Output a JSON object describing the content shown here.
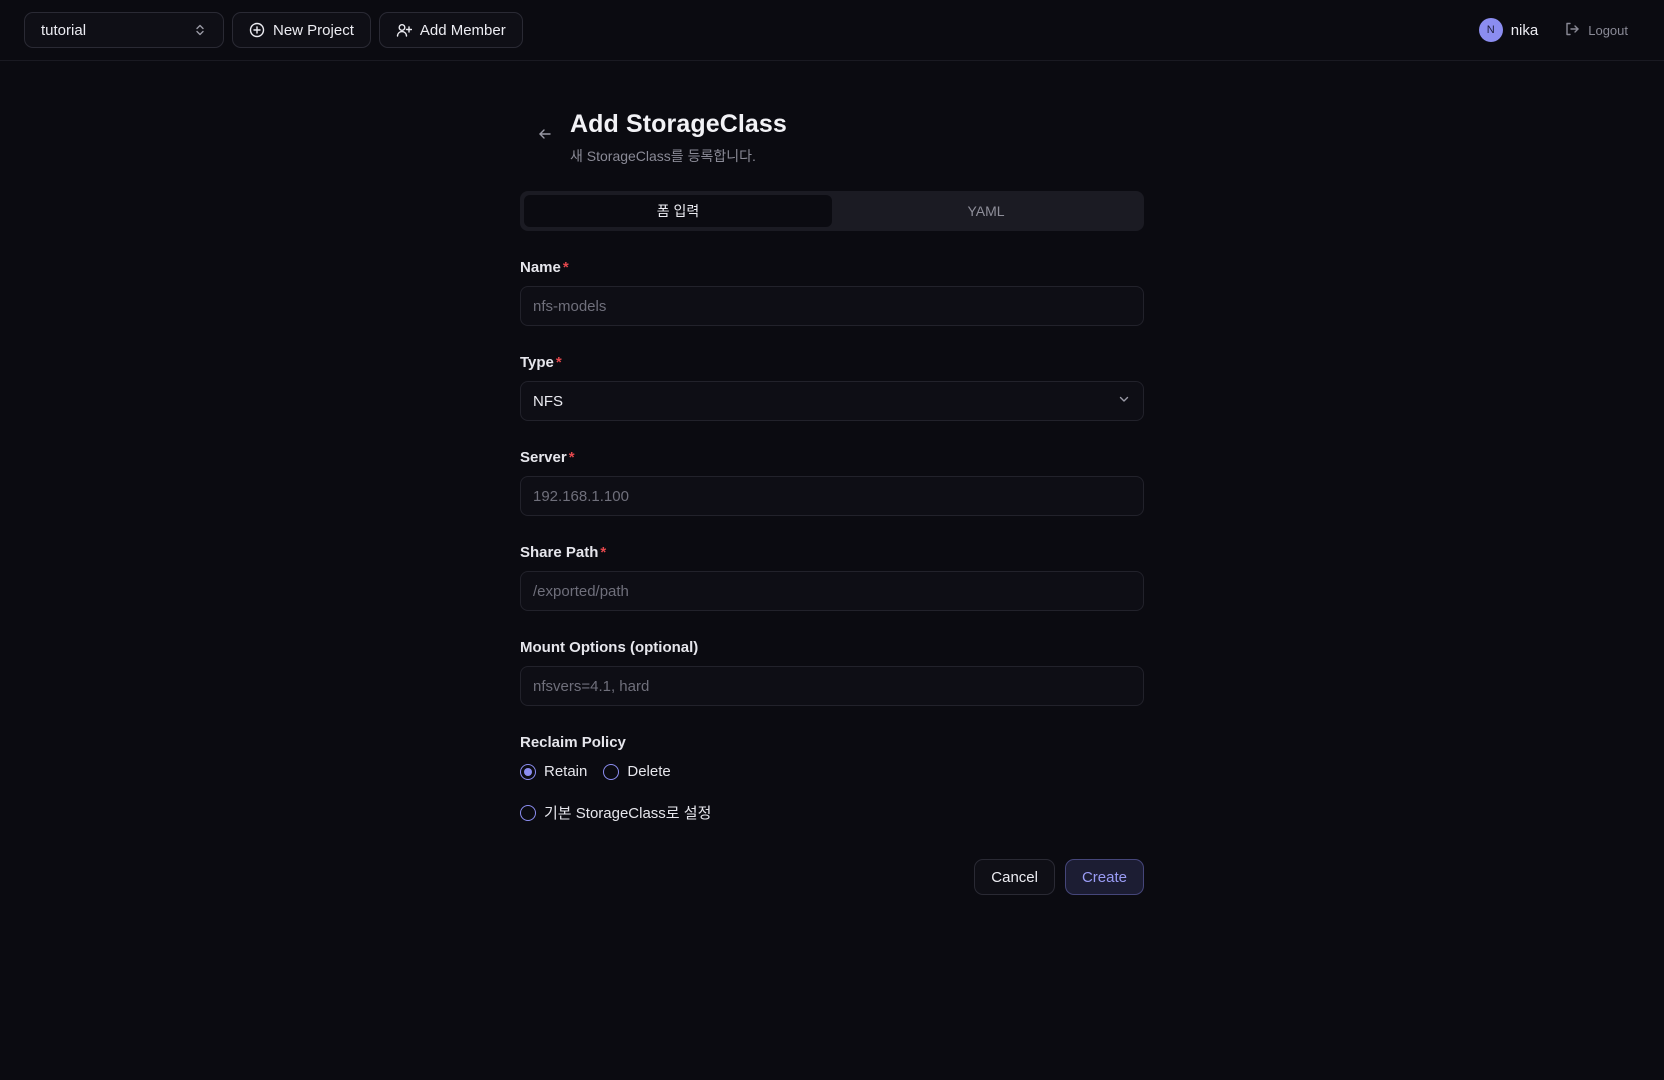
{
  "topbar": {
    "project_select_value": "tutorial",
    "new_project_label": "New Project",
    "add_member_label": "Add Member",
    "avatar_initial": "N",
    "username": "nika",
    "logout_label": "Logout"
  },
  "page": {
    "title": "Add StorageClass",
    "subtitle": "새 StorageClass를 등록합니다."
  },
  "tabs": [
    {
      "label": "폼 입력",
      "active": true
    },
    {
      "label": "YAML",
      "active": false
    }
  ],
  "form": {
    "name": {
      "label": "Name",
      "required": "*",
      "placeholder": "nfs-models",
      "value": ""
    },
    "type": {
      "label": "Type",
      "required": "*",
      "value": "NFS"
    },
    "server": {
      "label": "Server",
      "required": "*",
      "placeholder": "192.168.1.100",
      "value": ""
    },
    "share_path": {
      "label": "Share Path",
      "required": "*",
      "placeholder": "/exported/path",
      "value": ""
    },
    "mount_options": {
      "label": "Mount Options (optional)",
      "placeholder": "nfsvers=4.1, hard",
      "value": ""
    },
    "reclaim_policy": {
      "label": "Reclaim Policy",
      "options": [
        {
          "label": "Retain",
          "checked": true
        },
        {
          "label": "Delete",
          "checked": false
        }
      ]
    },
    "default_storageclass": {
      "label": "기본 StorageClass로 설정",
      "checked": false
    }
  },
  "actions": {
    "cancel_label": "Cancel",
    "create_label": "Create"
  },
  "colors": {
    "background": "#0b0b11",
    "accent": "#8b8df0",
    "required": "#e5484d"
  },
  "icons": {
    "project_select": "chevron-up-down-icon",
    "new_project": "plus-circle-icon",
    "add_member": "user-plus-icon",
    "logout": "logout-icon",
    "back": "arrow-left-icon",
    "select": "chevron-down-icon"
  }
}
